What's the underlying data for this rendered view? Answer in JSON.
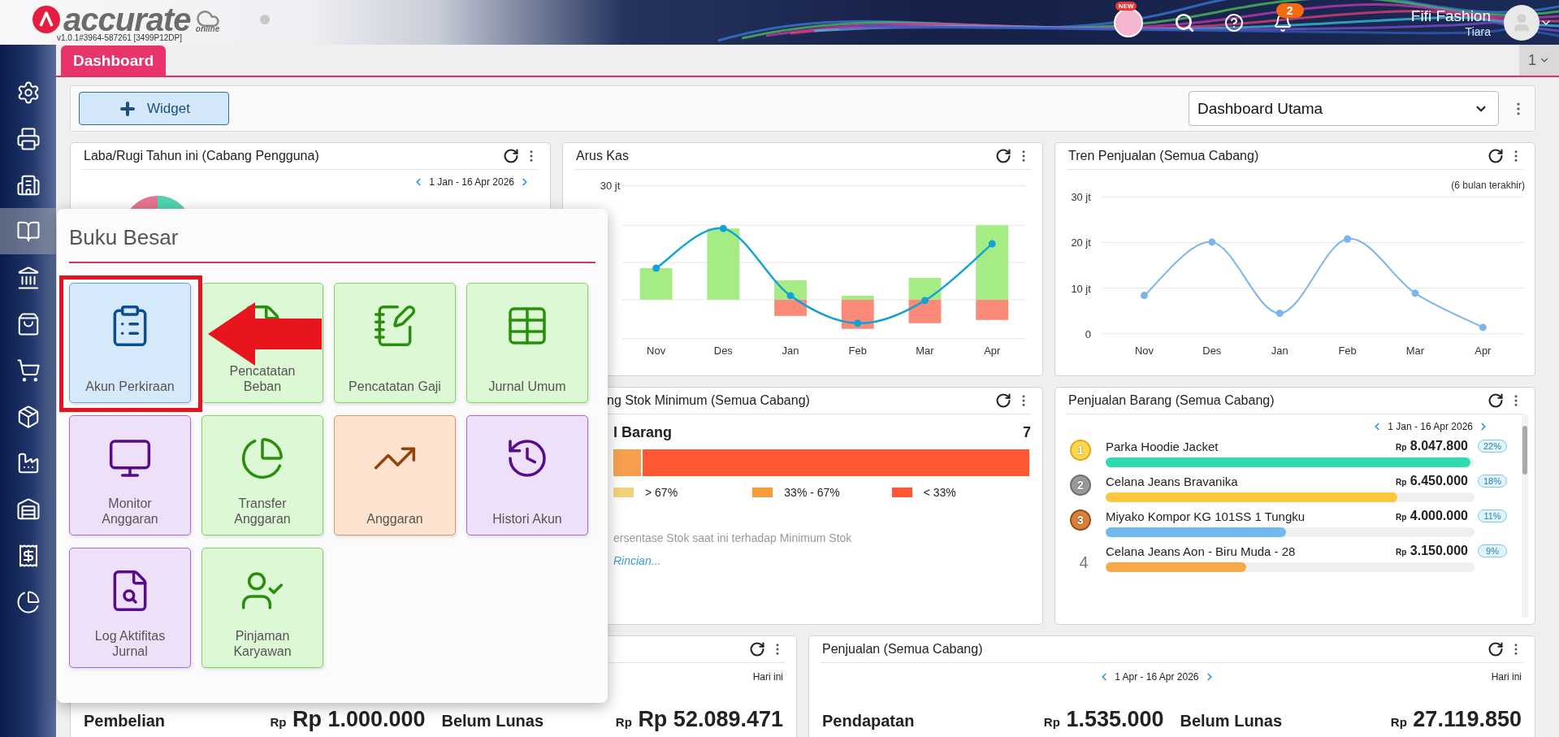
{
  "header": {
    "logo_text": "accurate",
    "logo_subtext": "online",
    "version": "v1.0.1#3964-587261 [3499P12DP]",
    "new_badge": "NEW",
    "notification_count": "2",
    "user_name": "Fifi Fashion",
    "user_role": "Tiara"
  },
  "sidebar": {
    "items": [
      {
        "selected": false
      },
      {
        "selected": false
      },
      {
        "selected": false
      },
      {
        "selected": true
      },
      {
        "selected": false
      },
      {
        "selected": false
      },
      {
        "selected": false
      },
      {
        "selected": false
      },
      {
        "selected": false
      },
      {
        "selected": false
      },
      {
        "selected": false
      },
      {
        "selected": false
      }
    ]
  },
  "tabs": [
    {
      "label": "Dashboard",
      "selected": true
    }
  ],
  "page_switch": "1",
  "toolbar": {
    "add_button": "Widget",
    "dashboard_select": "Dashboard Utama"
  },
  "widgets": {
    "profit_loss": {
      "title": "Laba/Rugi Tahun ini (Cabang Pengguna)",
      "date_range": "1 Jan - 16 Apr 2026"
    },
    "cash_flow": {
      "title": "Arus Kas",
      "y_label": "30 jt",
      "months": [
        "Nov",
        "Des",
        "Jan",
        "Feb",
        "Mar",
        "Apr"
      ]
    },
    "sales_trend": {
      "title": "Tren Penjualan (Semua Cabang)",
      "note": "(6 bulan terakhir)",
      "chart_data": {
        "type": "line",
        "categories": [
          "Nov",
          "Des",
          "Jan",
          "Feb",
          "Mar",
          "Apr"
        ],
        "series": [
          {
            "color": "#7cb5ec",
            "marker": true,
            "values": [
              8.4,
              20.1,
              4.5,
              20.8,
              8.9,
              1.4
            ]
          }
        ],
        "ylim": [
          0,
          30
        ],
        "yticks": [
          {
            "value": 0,
            "label": "0"
          },
          {
            "value": 10,
            "label": "10 jt"
          },
          {
            "value": 20,
            "label": "20 jt"
          },
          {
            "value": 30,
            "label": "30 jt"
          }
        ]
      }
    },
    "min_stock": {
      "title": "ng Stok Minimum (Semua Cabang)",
      "heading": "l Barang",
      "count": "7",
      "segments": [
        {
          "color": "#f6a04d",
          "level": 0.07
        },
        {
          "color": "#ff5733",
          "level": 0.93
        }
      ],
      "legend": [
        {
          "label": "> 67%",
          "color": "#f3d27c"
        },
        {
          "label": "33% - 67%",
          "color": "#f79a3a"
        },
        {
          "label": "< 33%",
          "color": "#ff5733"
        }
      ],
      "caption": "ersentase Stok saat ini terhadap Minimum Stok",
      "link": "Rincian..."
    },
    "item_sales": {
      "title": "Penjualan Barang (Semua Cabang)",
      "date_range": "1 Jan - 16 Apr 2026",
      "items": [
        {
          "rank": "1",
          "kind": "gold",
          "name": "Parka Hoodie Jacket",
          "currency": "Rp",
          "amount": "8.047.800",
          "share": "22%",
          "level": 0.99,
          "color": "#2fdcb0"
        },
        {
          "rank": "2",
          "kind": "silver",
          "name": "Celana Jeans Bravanika",
          "currency": "Rp",
          "amount": "6.450.000",
          "share": "18%",
          "level": 0.79,
          "color": "#fcc63d"
        },
        {
          "rank": "3",
          "kind": "bronze",
          "name": "Miyako Kompor KG 101SS 1 Tungku",
          "currency": "Rp",
          "amount": "4.000.000",
          "share": "11%",
          "level": 0.49,
          "color": "#71b9ee"
        },
        {
          "rank": "4",
          "kind": "plain",
          "name": "Celana Jeans Aon - Biru Muda - 28",
          "currency": "Rp",
          "amount": "3.150.000",
          "share": "9%",
          "level": 0.38,
          "color": "#f6a94b"
        }
      ]
    },
    "purchases": {
      "period": "Hari ini",
      "stats": [
        {
          "label": "Pembelian",
          "currency": "Rp",
          "amount": "Rp 1.000.000"
        },
        {
          "label": "Belum Lunas",
          "currency": "Rp",
          "amount": "Rp 52.089.471"
        }
      ]
    },
    "sales": {
      "title": "Penjualan (Semua Cabang)",
      "date_range": "1 Apr - 16 Apr 2026",
      "period": "Hari ini",
      "stats": [
        {
          "label": "Pendapatan",
          "currency": "Rp",
          "amount": "1.535.000"
        },
        {
          "label": "Belum Lunas",
          "currency": "Rp",
          "amount": "27.119.850"
        }
      ]
    }
  },
  "popup": {
    "title": "Buku Besar",
    "tiles": [
      {
        "label": "Akun Perkiraan",
        "color": "#d6e9fb",
        "selected": true
      },
      {
        "label": "Pencatatan Beban",
        "color": "#dcf8d4",
        "selected": false
      },
      {
        "label": "Pencatatan Gaji",
        "color": "#dcf8d4",
        "selected": false
      },
      {
        "label": "Jurnal Umum",
        "color": "#dcf8d4",
        "selected": false
      },
      {
        "label": "Monitor Anggaran",
        "color": "#efe0fa",
        "selected": false
      },
      {
        "label": "Transfer Anggaran",
        "color": "#dcf8d4",
        "selected": false
      },
      {
        "label": "Anggaran",
        "color": "#fde3cf",
        "selected": false
      },
      {
        "label": "Histori Akun",
        "color": "#efe0fa",
        "selected": false
      },
      {
        "label": "Log Aktifitas Jurnal",
        "color": "#efe0fa",
        "selected": false
      },
      {
        "label": "Pinjaman Karyawan",
        "color": "#dcf8d4",
        "selected": false
      }
    ]
  }
}
